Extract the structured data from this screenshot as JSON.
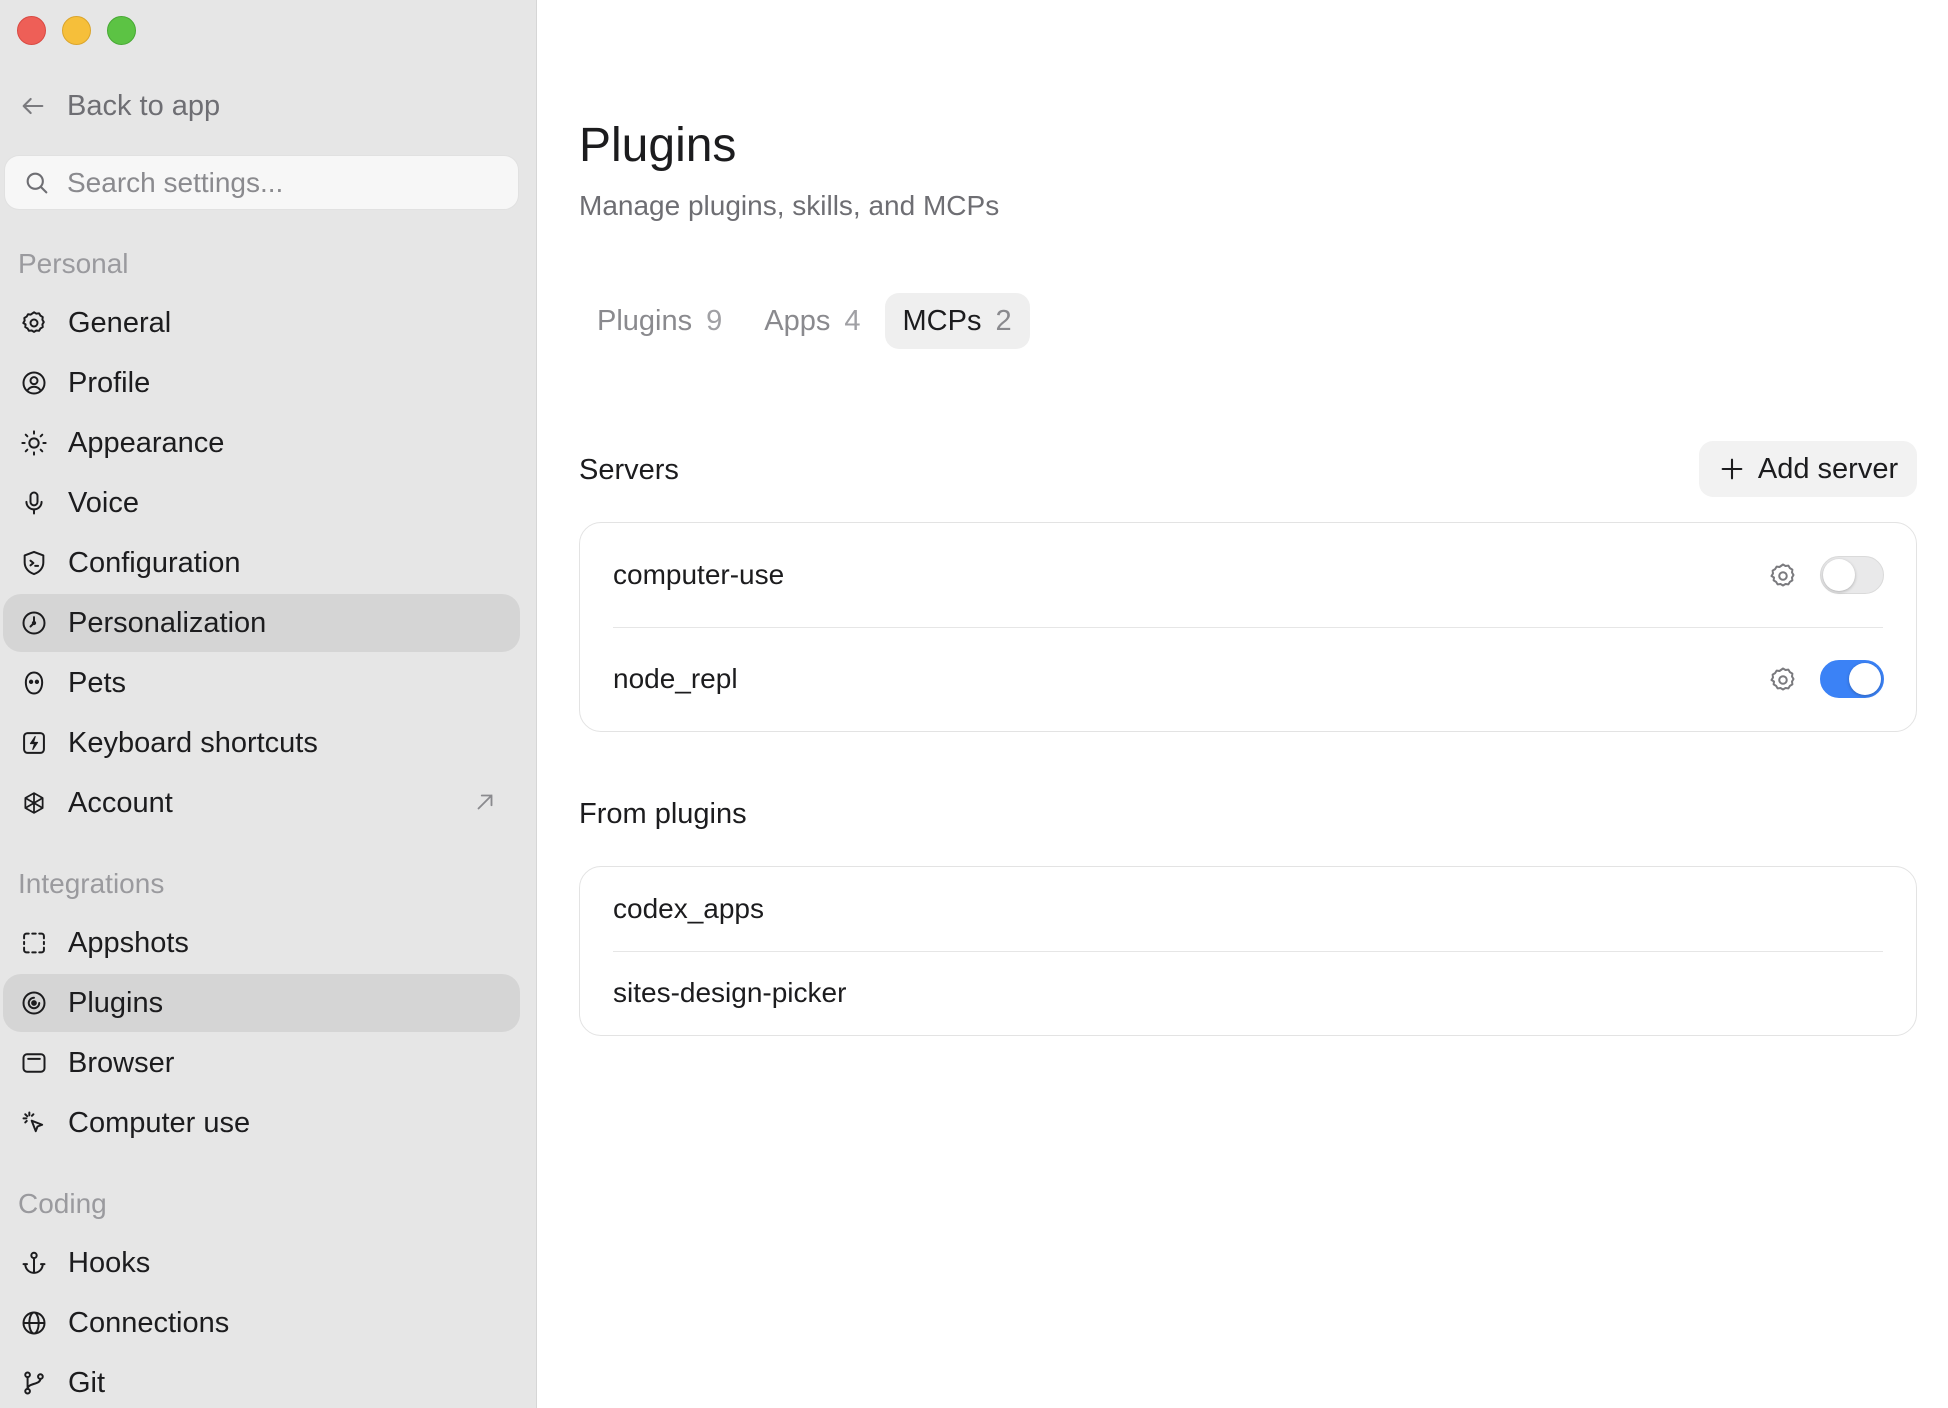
{
  "window": {
    "traffic_lights": [
      "close",
      "minimize",
      "zoom"
    ]
  },
  "sidebar": {
    "back_label": "Back to app",
    "search_placeholder": "Search settings...",
    "sections": [
      {
        "label": "Personal",
        "items": [
          {
            "label": "General",
            "icon": "gear-icon"
          },
          {
            "label": "Profile",
            "icon": "user-circle-icon"
          },
          {
            "label": "Appearance",
            "icon": "sun-icon"
          },
          {
            "label": "Voice",
            "icon": "microphone-icon"
          },
          {
            "label": "Configuration",
            "icon": "shield-terminal-icon"
          },
          {
            "label": "Personalization",
            "icon": "personalization-icon",
            "active": true
          },
          {
            "label": "Pets",
            "icon": "pet-icon"
          },
          {
            "label": "Keyboard shortcuts",
            "icon": "keyboard-bolt-icon"
          },
          {
            "label": "Account",
            "icon": "openai-icon",
            "external": true
          }
        ]
      },
      {
        "label": "Integrations",
        "items": [
          {
            "label": "Appshots",
            "icon": "screenshot-icon"
          },
          {
            "label": "Plugins",
            "icon": "plugin-icon",
            "active": true
          },
          {
            "label": "Browser",
            "icon": "browser-icon"
          },
          {
            "label": "Computer use",
            "icon": "cursor-click-icon"
          }
        ]
      },
      {
        "label": "Coding",
        "items": [
          {
            "label": "Hooks",
            "icon": "anchor-icon"
          },
          {
            "label": "Connections",
            "icon": "globe-icon"
          },
          {
            "label": "Git",
            "icon": "git-branch-icon"
          }
        ]
      }
    ]
  },
  "main": {
    "title": "Plugins",
    "subtitle": "Manage plugins, skills, and MCPs",
    "tabs": [
      {
        "label": "Plugins",
        "count": "9"
      },
      {
        "label": "Apps",
        "count": "4"
      },
      {
        "label": "MCPs",
        "count": "2",
        "active": true
      }
    ],
    "servers": {
      "heading": "Servers",
      "add_label": "Add server",
      "items": [
        {
          "name": "computer-use",
          "enabled": false
        },
        {
          "name": "node_repl",
          "enabled": true
        }
      ]
    },
    "from_plugins": {
      "heading": "From plugins",
      "items": [
        {
          "name": "codex_apps"
        },
        {
          "name": "sites-design-picker"
        }
      ]
    }
  },
  "colors": {
    "toggle_on": "#3b82f6",
    "sidebar_bg": "#e6e6e6",
    "active_item_bg": "#d5d5d5"
  }
}
